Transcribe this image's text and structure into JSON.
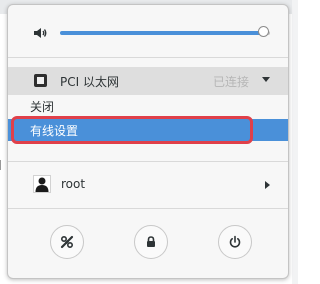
{
  "volume": {
    "level": 0.97
  },
  "network": {
    "label": "PCI 以太网",
    "status": "已连接",
    "submenu": {
      "close_label": "关闭",
      "wired_settings_label": "有线设置"
    }
  },
  "user": {
    "name": "root"
  },
  "colors": {
    "accent": "#4a90d9",
    "highlight_outline": "#e0404a"
  },
  "actions": {
    "settings_icon": "settings-icon",
    "lock_icon": "lock-icon",
    "power_icon": "power-icon"
  }
}
